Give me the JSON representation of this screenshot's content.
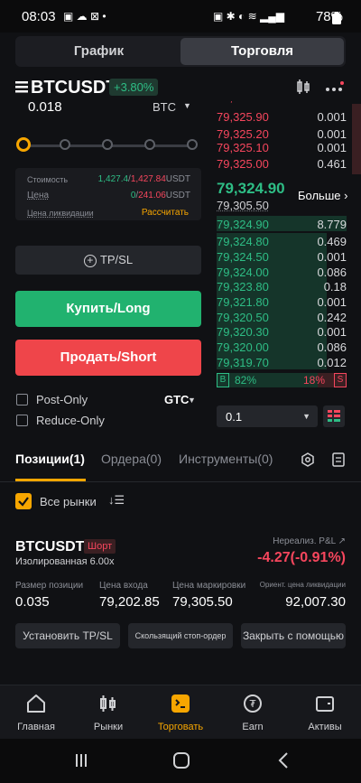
{
  "status": {
    "time": "08:03",
    "battery": "78%"
  },
  "tabs": {
    "chart": "График",
    "trade": "Торговля"
  },
  "pair": {
    "symbol": "BTCUSDT",
    "change": "+3.80%"
  },
  "order_form": {
    "qty_value": "0.018",
    "qty_unit": "BTC",
    "cost_label": "Стоимость",
    "cost_buy": "1,427.4",
    "cost_sell": "1,427.84",
    "cost_unit": "USDT",
    "price_label": "Цена",
    "price_buy": "0",
    "price_sell": "241.06",
    "price_unit": "USDT",
    "liq_label": "Цена ликвидации",
    "liq_action": "Рассчитать",
    "tpsl": "TP/SL",
    "buy": "Купить/Long",
    "sell": "Продать/Short",
    "post_only": "Post-Only",
    "reduce_only": "Reduce-Only",
    "tif": "GTC"
  },
  "orderbook": {
    "asks": [
      {
        "price": "79,325.90",
        "qty": "0.001"
      },
      {
        "price": "79,325.20",
        "qty": "0.001"
      },
      {
        "price": "79,325.10",
        "qty": "0.001"
      },
      {
        "price": "79,325.00",
        "qty": "0.461"
      }
    ],
    "last_price": "79,324.90",
    "mark_price": "79,305.50",
    "more": "Больше",
    "bids": [
      {
        "price": "79,324.90",
        "qty": "8.779",
        "depth": 1.0
      },
      {
        "price": "79,324.80",
        "qty": "0.469",
        "depth": 0.85
      },
      {
        "price": "79,324.50",
        "qty": "0.001",
        "depth": 0.85
      },
      {
        "price": "79,324.00",
        "qty": "0.086",
        "depth": 0.85
      },
      {
        "price": "79,323.80",
        "qty": "0.18",
        "depth": 0.85
      },
      {
        "price": "79,321.80",
        "qty": "0.001",
        "depth": 0.85
      },
      {
        "price": "79,320.50",
        "qty": "0.242",
        "depth": 0.85
      },
      {
        "price": "79,320.30",
        "qty": "0.001",
        "depth": 0.85
      },
      {
        "price": "79,320.00",
        "qty": "0.086",
        "depth": 0.85
      },
      {
        "price": "79,319.70",
        "qty": "0.012",
        "depth": 0.85
      }
    ],
    "buy_ratio": "82%",
    "sell_ratio": "18%",
    "buy_tag": "B",
    "sell_tag": "S",
    "depth_step": "0.1"
  },
  "positions_tabs": {
    "positions": "Позиции(1)",
    "orders": "Ордера(0)",
    "tools": "Инструменты(0)"
  },
  "all_markets": "Все рынки",
  "position": {
    "symbol": "BTCUSDT",
    "side": "Шорт",
    "margin_mode": "Изолированная 6.00x",
    "pnl_label": "Нереализ. P&L",
    "pnl_value": "-4.27(-0.91%)",
    "size_label": "Размер позиции",
    "size": "0.035",
    "entry_label": "Цена входа",
    "entry": "79,202.85",
    "mark_label": "Цена маркировки",
    "mark": "79,305.50",
    "liq_label": "Ориент. цена ликвидации",
    "liq": "92,007.30",
    "btn_tpsl": "Установить TP/SL",
    "btn_trailing": "Скользящий стоп-ордер",
    "btn_close": "Закрыть с помощью"
  },
  "nav": {
    "home": "Главная",
    "markets": "Рынки",
    "trade": "Торговать",
    "earn": "Earn",
    "assets": "Активы"
  }
}
